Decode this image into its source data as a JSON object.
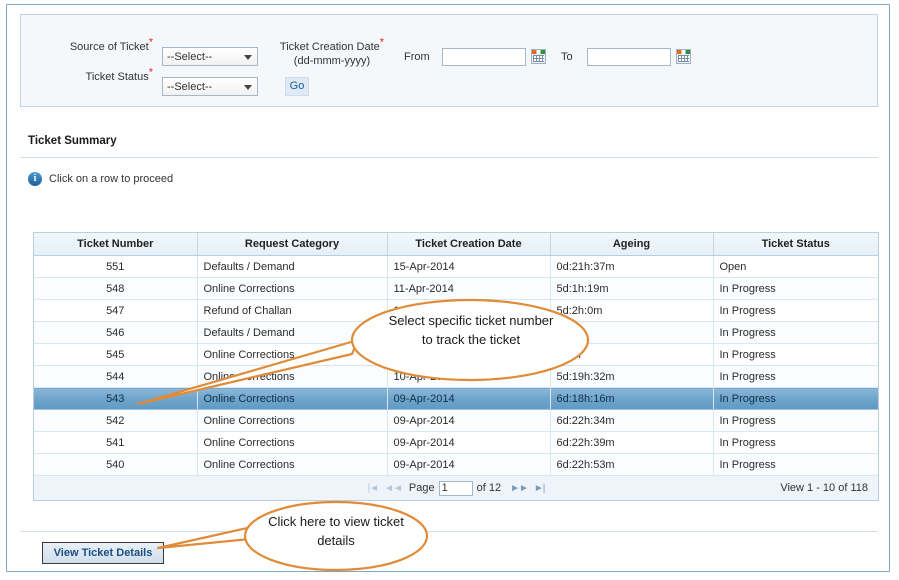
{
  "filters": {
    "source_of_ticket": {
      "label": "Source of Ticket",
      "required_mark": "*",
      "value": "--Select--",
      "options": [
        "--Select--"
      ]
    },
    "ticket_status": {
      "label": "Ticket Status",
      "required_mark": "*",
      "value": "--Select--",
      "options": [
        "--Select--"
      ]
    },
    "ticket_creation_date": {
      "label": "Ticket Creation Date",
      "required_mark": "*",
      "format_hint": "(dd-mmm-yyyy)"
    },
    "from": {
      "label": "From",
      "value": "",
      "placeholder": ""
    },
    "to": {
      "label": "To",
      "value": "",
      "placeholder": ""
    },
    "go_button": "Go",
    "calendar_icon": "calendar-icon"
  },
  "section": {
    "title": "Ticket Summary",
    "info_message": "Click on a row to proceed",
    "info_icon": "info-icon"
  },
  "grid": {
    "columns": [
      "Ticket Number",
      "Request Category",
      "Ticket Creation Date",
      "Ageing",
      "Ticket Status"
    ],
    "rows": [
      {
        "ticket_number": "551",
        "request_category": "Defaults / Demand",
        "creation_date": "15-Apr-2014",
        "ageing": "0d:21h:37m",
        "status": "Open",
        "selected": false
      },
      {
        "ticket_number": "548",
        "request_category": "Online Corrections",
        "creation_date": "11-Apr-2014",
        "ageing": "5d:1h:19m",
        "status": "In Progress",
        "selected": false
      },
      {
        "ticket_number": "547",
        "request_category": "Refund of Challan",
        "creation_date": "11-Apr-2014",
        "ageing": "5d:2h:0m",
        "status": "In Progress",
        "selected": false
      },
      {
        "ticket_number": "546",
        "request_category": "Defaults / Demand",
        "creation_date": "",
        "ageing": "5m",
        "status": "In Progress",
        "selected": false
      },
      {
        "ticket_number": "545",
        "request_category": "Online Corrections",
        "creation_date": "",
        "ageing": "h:6m",
        "status": "In Progress",
        "selected": false
      },
      {
        "ticket_number": "544",
        "request_category": "Online Corrections",
        "creation_date": "10-Apr-2014",
        "ageing": "5d:19h:32m",
        "status": "In Progress",
        "selected": false
      },
      {
        "ticket_number": "543",
        "request_category": "Online Corrections",
        "creation_date": "09-Apr-2014",
        "ageing": "6d:18h:16m",
        "status": "In Progress",
        "selected": true
      },
      {
        "ticket_number": "542",
        "request_category": "Online Corrections",
        "creation_date": "09-Apr-2014",
        "ageing": "6d:22h:34m",
        "status": "In Progress",
        "selected": false
      },
      {
        "ticket_number": "541",
        "request_category": "Online Corrections",
        "creation_date": "09-Apr-2014",
        "ageing": "6d:22h:39m",
        "status": "In Progress",
        "selected": false
      },
      {
        "ticket_number": "540",
        "request_category": "Online Corrections",
        "creation_date": "09-Apr-2014",
        "ageing": "6d:22h:53m",
        "status": "In Progress",
        "selected": false
      }
    ]
  },
  "pager": {
    "first_icon": "first-page-icon",
    "prev_icon": "previous-page-icon",
    "page_label": "Page",
    "page_value": "1",
    "of_label": "of 12",
    "next_icon": "next-page-icon",
    "last_icon": "last-page-icon",
    "view_range": "View 1 - 10 of 118"
  },
  "footer": {
    "view_ticket_details_button": "View Ticket Details"
  },
  "annotations": {
    "callout_row": "Select specific ticket number to track the ticket",
    "callout_button": "Click here to view ticket details",
    "accent_color": "#e08b38"
  }
}
